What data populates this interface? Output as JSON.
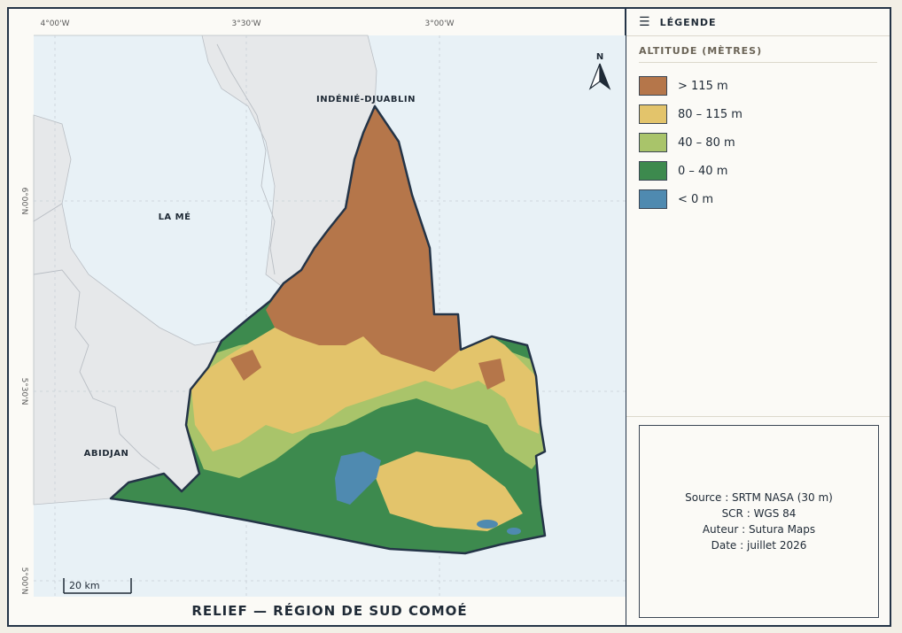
{
  "map": {
    "title": "RELIEF — RÉGION DE SUD COMOÉ",
    "graticule": {
      "longitudes": [
        "4°00'W",
        "3°30'W",
        "3°00'W"
      ],
      "latitudes": [
        "6°00'N",
        "5°30'N",
        "5°00'N"
      ]
    },
    "places": {
      "indenie": "INDÉNIÉ-DJUABLIN",
      "la_me": "LA MÉ",
      "abidjan": "ABIDJAN"
    },
    "north_arrow_label": "N",
    "scale_bar_label": "20 km",
    "colors": {
      "ocean": "#e8f1f6",
      "land": "#e6e8ea",
      "border": "#243447",
      "gt115": "#b5764a",
      "r80_115": "#e3c46b",
      "r40_80": "#a9c46a",
      "r0_40": "#3d8a4e",
      "lt0": "#4f8ab0"
    }
  },
  "legend": {
    "header": "LÉGENDE",
    "subheader": "ALTITUDE (MÈTRES)",
    "items": [
      {
        "label": "> 115 m",
        "color": "#b5764a"
      },
      {
        "label": "80 – 115 m",
        "color": "#e3c46b"
      },
      {
        "label": "40 – 80 m",
        "color": "#a9c46a"
      },
      {
        "label": "0 – 40 m",
        "color": "#3d8a4e"
      },
      {
        "label": "< 0 m",
        "color": "#4f8ab0"
      }
    ]
  },
  "metadata": {
    "source": "Source : SRTM NASA (30 m)",
    "scr": "SCR : WGS 84",
    "author": "Auteur : Sutura Maps",
    "date": "Date : juillet 2026"
  }
}
